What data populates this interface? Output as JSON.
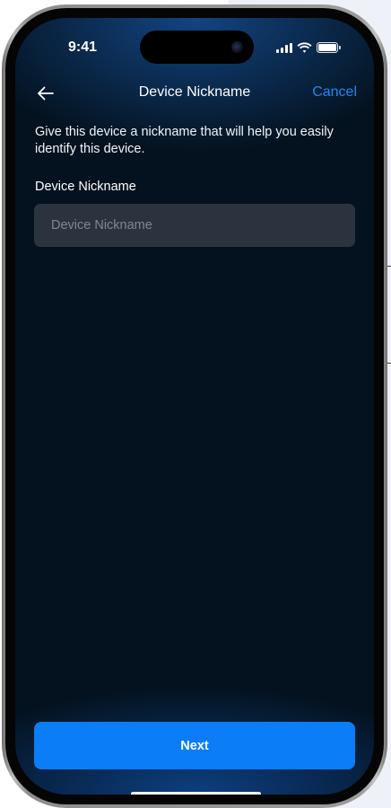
{
  "status_bar": {
    "time": "9:41",
    "icons": [
      "signal-icon",
      "wifi-icon",
      "battery-icon"
    ]
  },
  "header": {
    "back_icon": "arrow-left-icon",
    "title": "Device Nickname",
    "cancel_label": "Cancel"
  },
  "content": {
    "description": "Give this device a nickname that will help you easily identify this device.",
    "field_label": "Device Nickname",
    "field_placeholder": "Device Nickname",
    "field_value": ""
  },
  "footer": {
    "next_label": "Next"
  },
  "colors": {
    "accent": "#0a7df7",
    "link": "#1e88f0",
    "screen_background": "#04121f",
    "input_background": "#2b343e"
  }
}
